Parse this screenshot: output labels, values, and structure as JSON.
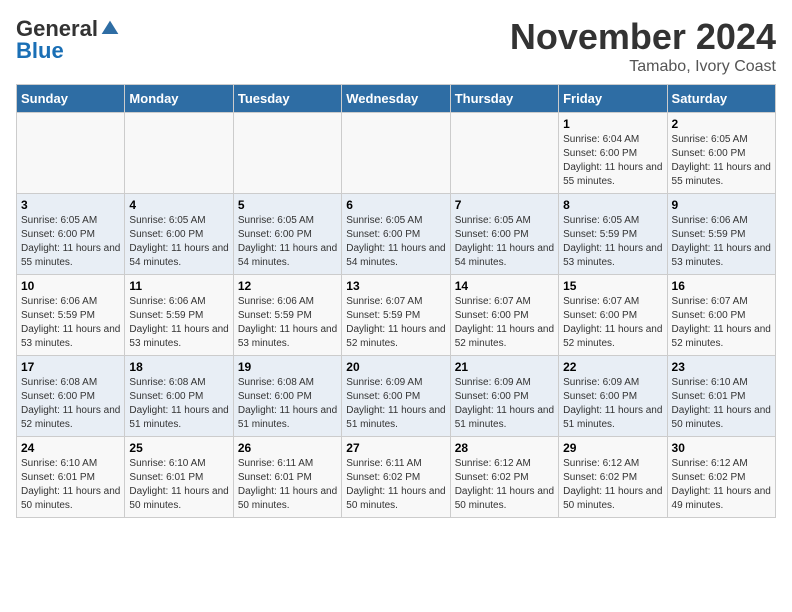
{
  "header": {
    "logo_general": "General",
    "logo_blue": "Blue",
    "month": "November 2024",
    "location": "Tamabo, Ivory Coast"
  },
  "weekdays": [
    "Sunday",
    "Monday",
    "Tuesday",
    "Wednesday",
    "Thursday",
    "Friday",
    "Saturday"
  ],
  "weeks": [
    [
      {
        "day": "",
        "info": ""
      },
      {
        "day": "",
        "info": ""
      },
      {
        "day": "",
        "info": ""
      },
      {
        "day": "",
        "info": ""
      },
      {
        "day": "",
        "info": ""
      },
      {
        "day": "1",
        "info": "Sunrise: 6:04 AM\nSunset: 6:00 PM\nDaylight: 11 hours and 55 minutes."
      },
      {
        "day": "2",
        "info": "Sunrise: 6:05 AM\nSunset: 6:00 PM\nDaylight: 11 hours and 55 minutes."
      }
    ],
    [
      {
        "day": "3",
        "info": "Sunrise: 6:05 AM\nSunset: 6:00 PM\nDaylight: 11 hours and 55 minutes."
      },
      {
        "day": "4",
        "info": "Sunrise: 6:05 AM\nSunset: 6:00 PM\nDaylight: 11 hours and 54 minutes."
      },
      {
        "day": "5",
        "info": "Sunrise: 6:05 AM\nSunset: 6:00 PM\nDaylight: 11 hours and 54 minutes."
      },
      {
        "day": "6",
        "info": "Sunrise: 6:05 AM\nSunset: 6:00 PM\nDaylight: 11 hours and 54 minutes."
      },
      {
        "day": "7",
        "info": "Sunrise: 6:05 AM\nSunset: 6:00 PM\nDaylight: 11 hours and 54 minutes."
      },
      {
        "day": "8",
        "info": "Sunrise: 6:05 AM\nSunset: 5:59 PM\nDaylight: 11 hours and 53 minutes."
      },
      {
        "day": "9",
        "info": "Sunrise: 6:06 AM\nSunset: 5:59 PM\nDaylight: 11 hours and 53 minutes."
      }
    ],
    [
      {
        "day": "10",
        "info": "Sunrise: 6:06 AM\nSunset: 5:59 PM\nDaylight: 11 hours and 53 minutes."
      },
      {
        "day": "11",
        "info": "Sunrise: 6:06 AM\nSunset: 5:59 PM\nDaylight: 11 hours and 53 minutes."
      },
      {
        "day": "12",
        "info": "Sunrise: 6:06 AM\nSunset: 5:59 PM\nDaylight: 11 hours and 53 minutes."
      },
      {
        "day": "13",
        "info": "Sunrise: 6:07 AM\nSunset: 5:59 PM\nDaylight: 11 hours and 52 minutes."
      },
      {
        "day": "14",
        "info": "Sunrise: 6:07 AM\nSunset: 6:00 PM\nDaylight: 11 hours and 52 minutes."
      },
      {
        "day": "15",
        "info": "Sunrise: 6:07 AM\nSunset: 6:00 PM\nDaylight: 11 hours and 52 minutes."
      },
      {
        "day": "16",
        "info": "Sunrise: 6:07 AM\nSunset: 6:00 PM\nDaylight: 11 hours and 52 minutes."
      }
    ],
    [
      {
        "day": "17",
        "info": "Sunrise: 6:08 AM\nSunset: 6:00 PM\nDaylight: 11 hours and 52 minutes."
      },
      {
        "day": "18",
        "info": "Sunrise: 6:08 AM\nSunset: 6:00 PM\nDaylight: 11 hours and 51 minutes."
      },
      {
        "day": "19",
        "info": "Sunrise: 6:08 AM\nSunset: 6:00 PM\nDaylight: 11 hours and 51 minutes."
      },
      {
        "day": "20",
        "info": "Sunrise: 6:09 AM\nSunset: 6:00 PM\nDaylight: 11 hours and 51 minutes."
      },
      {
        "day": "21",
        "info": "Sunrise: 6:09 AM\nSunset: 6:00 PM\nDaylight: 11 hours and 51 minutes."
      },
      {
        "day": "22",
        "info": "Sunrise: 6:09 AM\nSunset: 6:00 PM\nDaylight: 11 hours and 51 minutes."
      },
      {
        "day": "23",
        "info": "Sunrise: 6:10 AM\nSunset: 6:01 PM\nDaylight: 11 hours and 50 minutes."
      }
    ],
    [
      {
        "day": "24",
        "info": "Sunrise: 6:10 AM\nSunset: 6:01 PM\nDaylight: 11 hours and 50 minutes."
      },
      {
        "day": "25",
        "info": "Sunrise: 6:10 AM\nSunset: 6:01 PM\nDaylight: 11 hours and 50 minutes."
      },
      {
        "day": "26",
        "info": "Sunrise: 6:11 AM\nSunset: 6:01 PM\nDaylight: 11 hours and 50 minutes."
      },
      {
        "day": "27",
        "info": "Sunrise: 6:11 AM\nSunset: 6:02 PM\nDaylight: 11 hours and 50 minutes."
      },
      {
        "day": "28",
        "info": "Sunrise: 6:12 AM\nSunset: 6:02 PM\nDaylight: 11 hours and 50 minutes."
      },
      {
        "day": "29",
        "info": "Sunrise: 6:12 AM\nSunset: 6:02 PM\nDaylight: 11 hours and 50 minutes."
      },
      {
        "day": "30",
        "info": "Sunrise: 6:12 AM\nSunset: 6:02 PM\nDaylight: 11 hours and 49 minutes."
      }
    ]
  ]
}
